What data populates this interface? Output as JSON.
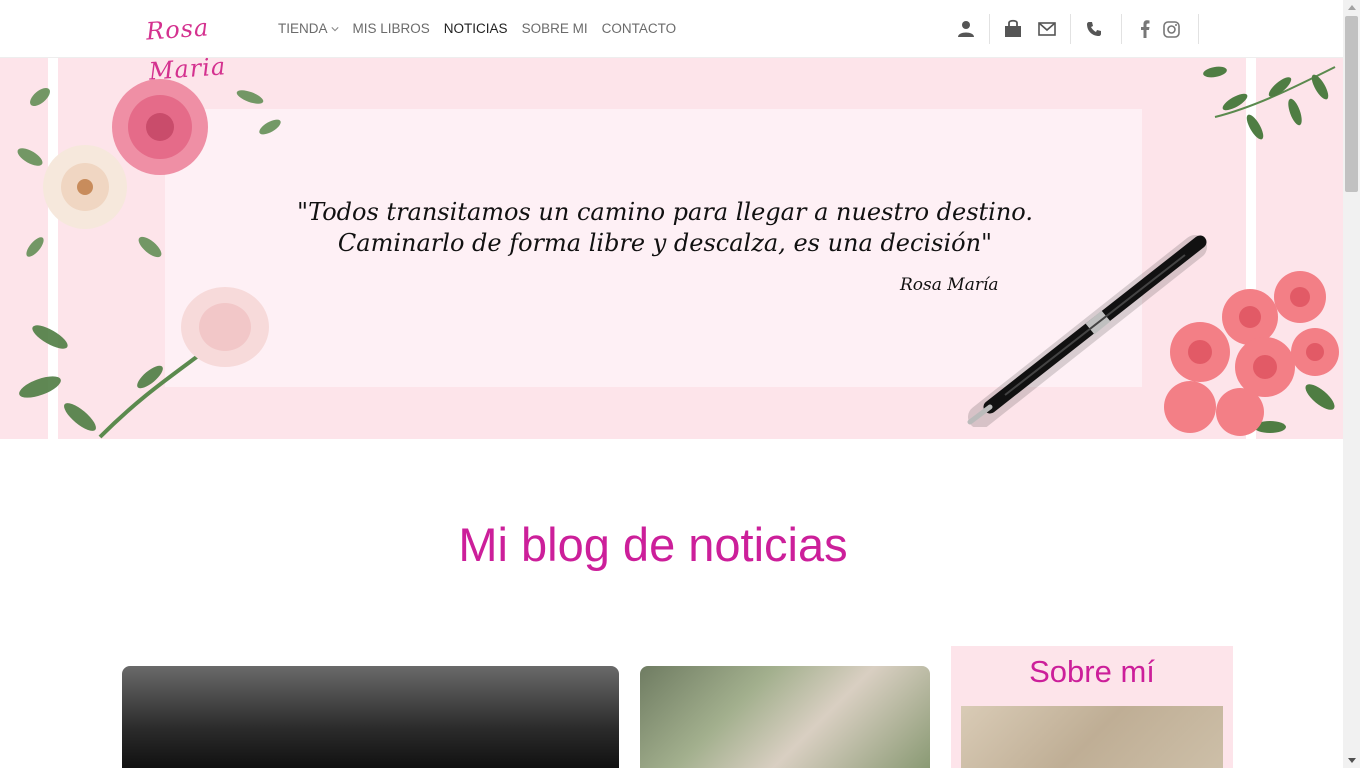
{
  "header": {
    "logo_text": "Rosa Maria",
    "nav": [
      {
        "label": "TIENDA",
        "has_dropdown": true
      },
      {
        "label": "MIS LIBROS"
      },
      {
        "label": "NOTICIAS",
        "active": true
      },
      {
        "label": "SOBRE MI"
      },
      {
        "label": "CONTACTO"
      }
    ],
    "icons": [
      "user-icon",
      "shopping-bag-icon",
      "mail-icon",
      "phone-icon",
      "facebook-icon",
      "instagram-icon"
    ]
  },
  "hero": {
    "quote_line1": "\"Todos transitamos un camino para llegar a nuestro destino.",
    "quote_line2": "Caminarlo de forma libre y descalza, es una decisión\"",
    "author": "Rosa María"
  },
  "main": {
    "title": "Mi blog de noticias"
  },
  "sidebar": {
    "title": "Sobre mí"
  },
  "colors": {
    "accent": "#cc1f9a",
    "hero_bg": "#fde4ea",
    "hero_card": "#fef0f5"
  }
}
